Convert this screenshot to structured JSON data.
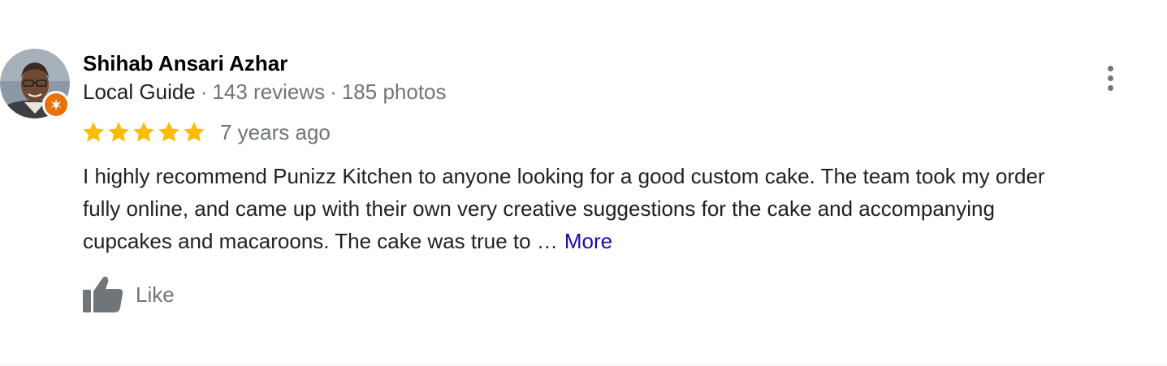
{
  "review": {
    "author": {
      "name": "Shihab Ansari Azhar",
      "guide_label": "Local Guide",
      "separator": "·",
      "reviews": "143 reviews",
      "photos": "185 photos",
      "avatar_icon": "person-photo",
      "badge_icon": "local-guide-star-icon",
      "badge_color": "#e8710a"
    },
    "rating": {
      "stars": 5,
      "max_stars": 5,
      "star_color": "#fbbc04",
      "time_ago": "7 years ago"
    },
    "menu_icon": "more-vert-icon",
    "text_lines": [
      "I highly recommend Punizz Kitchen to anyone looking for a good custom cake. The team took my order",
      "fully online, and came up with their own very creative suggestions for the cake and accompanying",
      "cupcakes and macaroons. The cake was true to …"
    ],
    "more_label": "More",
    "like": {
      "icon": "thumb-up-icon",
      "label": "Like"
    },
    "colors": {
      "name": "#000000",
      "secondary": "#70757a",
      "link": "#1a0dab"
    }
  }
}
